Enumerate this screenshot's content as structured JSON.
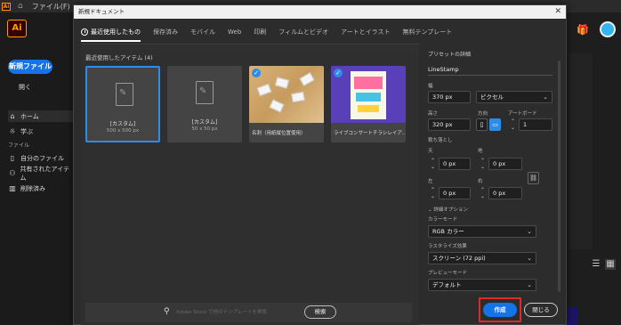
{
  "app": {
    "topbar_menu": "ファイル(F)",
    "logo": "Ai",
    "new_file": "新規ファイル",
    "open": "開く",
    "nav": [
      {
        "icon": "home-icon",
        "glyph": "⌂",
        "label": "ホーム"
      },
      {
        "icon": "learn-icon",
        "glyph": "☼",
        "label": "学ぶ"
      }
    ],
    "files_section": "ファイル",
    "files_nav": [
      {
        "icon": "file-icon",
        "glyph": "▯",
        "label": "自分のファイル"
      },
      {
        "icon": "shared-icon",
        "glyph": "⚇",
        "label": "共有されたアイテム"
      },
      {
        "icon": "trash-icon",
        "glyph": "🗑",
        "label": "削除済み"
      }
    ]
  },
  "dialog": {
    "title": "新規ドキュメント",
    "tabs": [
      "最近使用したもの",
      "保存済み",
      "モバイル",
      "Web",
      "印刷",
      "フィルムとビデオ",
      "アートとイラスト",
      "無料テンプレート"
    ],
    "recent_label": "最近使用したアイテム (4)",
    "cards": [
      {
        "title": "[カスタム]",
        "sub": "500 x 500 px"
      },
      {
        "title": "[カスタム]",
        "sub": "50 x 50 px"
      }
    ],
    "photo_cards": [
      {
        "caption": "名刺（用紙縦位置使用）"
      },
      {
        "caption": "ライブコンサートチラシレイア..."
      }
    ],
    "search": {
      "placeholder": "Adobe Stock で他のテンプレートを検索",
      "button": "検索"
    },
    "details": {
      "heading": "プリセットの詳細",
      "name": "LineStamp",
      "width_label": "幅",
      "width": "370 px",
      "unit": "ピクセル",
      "height_label": "高さ",
      "height": "320 px",
      "orientation_label": "方向",
      "artboard_label": "アートボード",
      "artboards": "1",
      "bleed_label": "裁ち落とし",
      "top_label": "天",
      "bottom_label": "地",
      "left_label": "左",
      "right_label": "右",
      "bleed_top": "0 px",
      "bleed_bottom": "0 px",
      "bleed_left": "0 px",
      "bleed_right": "0 px",
      "advanced_label": "詳細オプション",
      "color_mode_label": "カラーモード",
      "color_mode": "RGB カラー",
      "raster_label": "ラスタライズ効果",
      "raster": "スクリーン (72 ppi)",
      "preview_label": "プレビューモード",
      "preview": "デフォルト"
    },
    "create": "作成",
    "close": "閉じる"
  },
  "colors": {
    "accent": "#1473e6",
    "highlight": "#e0282a"
  }
}
